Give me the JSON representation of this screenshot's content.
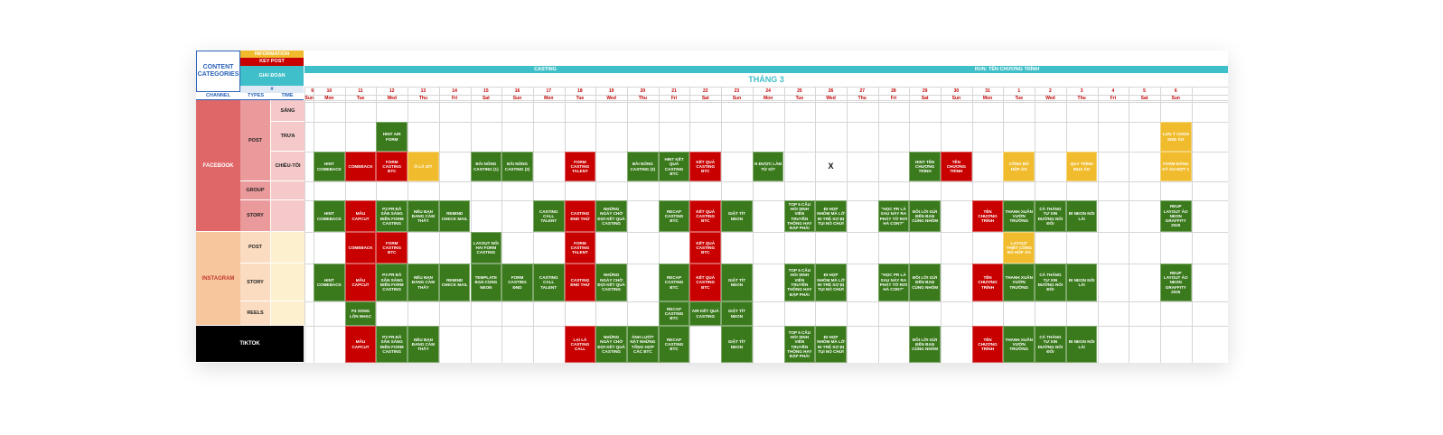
{
  "header": {
    "content_categories": "CONTENT CATEGORIES",
    "information": "INFORMATION",
    "key_post": "KEY POST",
    "giai_doan": "GIAI ĐOẠN",
    "hash": "#",
    "channel": "CHANNEL",
    "types": "TYPES",
    "time": "TIME",
    "phase_casting": "CASTING",
    "phase_run": "RUN: TÊN CHƯƠNG TRÌNH",
    "month": "THÁNG 3"
  },
  "colors": {
    "red": "#c80000",
    "green": "#3a7a1c",
    "yellow": "#f0bc2e",
    "teal": "#3fbfc9"
  },
  "days": [
    {
      "n": "9",
      "d": "Sun",
      "partial": true
    },
    {
      "n": "10",
      "d": "Mon"
    },
    {
      "n": "11",
      "d": "Tue"
    },
    {
      "n": "12",
      "d": "Wed"
    },
    {
      "n": "13",
      "d": "Thu"
    },
    {
      "n": "14",
      "d": "Fri"
    },
    {
      "n": "15",
      "d": "Sat"
    },
    {
      "n": "16",
      "d": "Sun"
    },
    {
      "n": "17",
      "d": "Mon"
    },
    {
      "n": "18",
      "d": "Tue"
    },
    {
      "n": "19",
      "d": "Wed"
    },
    {
      "n": "20",
      "d": "Thu"
    },
    {
      "n": "21",
      "d": "Fri"
    },
    {
      "n": "22",
      "d": "Sat"
    },
    {
      "n": "23",
      "d": "Sun"
    },
    {
      "n": "24",
      "d": "Mon"
    },
    {
      "n": "25",
      "d": "Tue"
    },
    {
      "n": "26",
      "d": "Wed"
    },
    {
      "n": "27",
      "d": "Thu"
    },
    {
      "n": "28",
      "d": "Fri"
    },
    {
      "n": "29",
      "d": "Sat"
    },
    {
      "n": "30",
      "d": "Sun"
    },
    {
      "n": "31",
      "d": "Mon"
    },
    {
      "n": "1",
      "d": "Tue"
    },
    {
      "n": "2",
      "d": "Wed"
    },
    {
      "n": "3",
      "d": "Thu"
    },
    {
      "n": "4",
      "d": "Fri"
    },
    {
      "n": "5",
      "d": "Sat"
    },
    {
      "n": "6",
      "d": "Sun"
    }
  ],
  "channels": [
    {
      "name": "FACEBOOK",
      "key": "fb"
    },
    {
      "name": "INSTAGRAM",
      "key": "ig"
    },
    {
      "name": "TIKTOK",
      "key": "tt"
    }
  ],
  "rows": [
    {
      "channel": "fb",
      "type": "POST",
      "time": "SÁNG"
    },
    {
      "channel": "fb",
      "type": "POST",
      "time": "TRƯA"
    },
    {
      "channel": "fb",
      "type": "POST",
      "time": "CHIỀU-TỐI"
    },
    {
      "channel": "fb",
      "type": "GROUP",
      "time": ""
    },
    {
      "channel": "fb",
      "type": "STORY",
      "time": ""
    },
    {
      "channel": "ig",
      "type": "POST",
      "time": ""
    },
    {
      "channel": "ig",
      "type": "STORY",
      "time": ""
    },
    {
      "channel": "ig",
      "type": "REELS",
      "time": ""
    },
    {
      "channel": "tt",
      "type": "",
      "time": ""
    }
  ],
  "cells": [
    {
      "r": 1,
      "c": 3,
      "t": "HINT AIR FORM",
      "k": "g"
    },
    {
      "r": 1,
      "c": 28,
      "t": "LƯU Ý CHỌN SIZE ÁO",
      "k": "y"
    },
    {
      "r": 2,
      "c": 1,
      "t": "HINT COMEBACK",
      "k": "g"
    },
    {
      "r": 2,
      "c": 2,
      "t": "COMEBACK",
      "k": "r"
    },
    {
      "r": 2,
      "c": 3,
      "t": "FORM CASTING BTC",
      "k": "r"
    },
    {
      "r": 2,
      "c": 4,
      "t": "Ô LÀ GÌ?",
      "k": "y"
    },
    {
      "r": 2,
      "c": 6,
      "t": "BÀI NÓNG CASTING (1)",
      "k": "g"
    },
    {
      "r": 2,
      "c": 7,
      "t": "BÀI NÓNG CASTING (2)",
      "k": "g"
    },
    {
      "r": 2,
      "c": 9,
      "t": "FORM CASTING TALENT",
      "k": "r"
    },
    {
      "r": 2,
      "c": 11,
      "t": "BÀI NÓNG CASTING (3)",
      "k": "g"
    },
    {
      "r": 2,
      "c": 12,
      "t": "HINT KẾT QUẢ CASTING BTC",
      "k": "g"
    },
    {
      "r": 2,
      "c": 13,
      "t": "KẾT QUẢ CASTING BTC",
      "k": "r"
    },
    {
      "r": 2,
      "c": 15,
      "t": "N ĐƯỢC LÀM TỪ GÌ?",
      "k": "g"
    },
    {
      "r": 2,
      "c": 17,
      "t": "X",
      "k": "x"
    },
    {
      "r": 2,
      "c": 20,
      "t": "HINT TÊN CHƯƠNG TRÌNH",
      "k": "g"
    },
    {
      "r": 2,
      "c": 21,
      "t": "TÊN CHƯƠNG TRÌNH",
      "k": "r"
    },
    {
      "r": 2,
      "c": 23,
      "t": "CÔNG BỐ HỘP ÁO",
      "k": "y"
    },
    {
      "r": 2,
      "c": 25,
      "t": "QUY TRÌNH MUA ÁO",
      "k": "y"
    },
    {
      "r": 2,
      "c": 28,
      "t": "FORM ĐĂNG KÝ ÁO ĐỢT 1",
      "k": "y"
    },
    {
      "r": 4,
      "c": 1,
      "t": "HINT COMEBACK",
      "k": "g"
    },
    {
      "r": 4,
      "c": 2,
      "t": "MẪU CAPCUT",
      "k": "r"
    },
    {
      "r": 4,
      "c": 3,
      "t": "P3 PR ĐÃ SẴN SÀNG ĐIỀN FORM CASTING",
      "k": "g"
    },
    {
      "r": 4,
      "c": 4,
      "t": "NẾU BẠN ĐANG CẢM THẤY",
      "k": "g"
    },
    {
      "r": 4,
      "c": 5,
      "t": "REMIND CHECK MAIL",
      "k": "g"
    },
    {
      "r": 4,
      "c": 8,
      "t": "CASTING CALL TALENT",
      "k": "g"
    },
    {
      "r": 4,
      "c": 9,
      "t": "CASTING ĐND THỬ",
      "k": "r"
    },
    {
      "r": 4,
      "c": 10,
      "t": "NHỮNG NGÀY CHỜ ĐỢI KẾT QUẢ CASTING",
      "k": "g"
    },
    {
      "r": 4,
      "c": 12,
      "t": "RECAP CASTING BTC",
      "k": "g"
    },
    {
      "r": 4,
      "c": 13,
      "t": "KẾT QUẢ CASTING BTC",
      "k": "r"
    },
    {
      "r": 4,
      "c": 14,
      "t": "GIẬT TÍT NEON",
      "k": "g"
    },
    {
      "r": 4,
      "c": 16,
      "t": "TOP 5 CÂU HỎI SINH VIÊN TRUYỀN THÔNG HAY ĐẶP PHẢI",
      "k": "g"
    },
    {
      "r": 4,
      "c": 17,
      "t": "ĐI HỌP NHÓM MÀ LỠ ĐI TRỄ SỢ BỊ TỤI NÓ CHỬI",
      "k": "g"
    },
    {
      "r": 4,
      "c": 19,
      "t": "\"HỌC PR LÀ SAU NÀY RA PHÁT TỜ RƠI HẢ CON?\"",
      "k": "g"
    },
    {
      "r": 4,
      "c": 20,
      "t": "ĐÔI LỜI GỬI ĐẾN BẠN CÙNG NHÓM",
      "k": "g"
    },
    {
      "r": 4,
      "c": 22,
      "t": "TÊN CHƯƠNG TRÌNH",
      "k": "r"
    },
    {
      "r": 4,
      "c": 23,
      "t": "THANH XUÂN VƯỜN TRƯỜNG",
      "k": "g"
    },
    {
      "r": 4,
      "c": 24,
      "t": "CÁ THÁNG TƯ XIN ĐƯỜNG NÓI ĐỐI",
      "k": "g"
    },
    {
      "r": 4,
      "c": 25,
      "t": "ĐI NEON NÓI LÁI",
      "k": "g"
    },
    {
      "r": 4,
      "c": 28,
      "t": "REUP LAYOUT ÁO NEON GRAFFITY 2025",
      "k": "g"
    },
    {
      "r": 5,
      "c": 2,
      "t": "COMEBACK",
      "k": "r"
    },
    {
      "r": 5,
      "c": 3,
      "t": "FORM CASTING BTC",
      "k": "r"
    },
    {
      "r": 5,
      "c": 6,
      "t": "LAYOUT NỐI HAI FORM CASTING",
      "k": "g"
    },
    {
      "r": 5,
      "c": 9,
      "t": "FORM CASTING TALENT",
      "k": "r"
    },
    {
      "r": 5,
      "c": 13,
      "t": "KẾT QUẢ CASTING BTC",
      "k": "r"
    },
    {
      "r": 5,
      "c": 23,
      "t": "LAYOUT THIẾT CÔNG BỐ HỘP ÁO",
      "k": "y"
    },
    {
      "r": 6,
      "c": 1,
      "t": "HINT COMEBACK",
      "k": "g"
    },
    {
      "r": 6,
      "c": 2,
      "t": "MẪU CAPCUT",
      "k": "r"
    },
    {
      "r": 6,
      "c": 3,
      "t": "P3 PR ĐÃ SẴN SÀNG ĐIỀN FORM CASTING",
      "k": "g"
    },
    {
      "r": 6,
      "c": 4,
      "t": "NẾU BẠN ĐANG CẢM THẤY",
      "k": "g"
    },
    {
      "r": 6,
      "c": 5,
      "t": "REMIND CHECK MAIL",
      "k": "g"
    },
    {
      "r": 6,
      "c": 6,
      "t": "TEMPLATE BẠN CÙNG NEON",
      "k": "g"
    },
    {
      "r": 6,
      "c": 7,
      "t": "FORM CASTING ĐND",
      "k": "g"
    },
    {
      "r": 6,
      "c": 8,
      "t": "CASTING CALL TALENT",
      "k": "g"
    },
    {
      "r": 6,
      "c": 9,
      "t": "CASTING ĐND THỬ",
      "k": "r"
    },
    {
      "r": 6,
      "c": 10,
      "t": "NHỮNG NGÀY CHỜ ĐỢI KẾT QUẢ CASTING",
      "k": "g"
    },
    {
      "r": 6,
      "c": 12,
      "t": "RECAP CASTING BTC",
      "k": "g"
    },
    {
      "r": 6,
      "c": 13,
      "t": "KẾT QUẢ CASTING BTC",
      "k": "r"
    },
    {
      "r": 6,
      "c": 14,
      "t": "GIẬT TÍT NEON",
      "k": "g"
    },
    {
      "r": 6,
      "c": 16,
      "t": "TOP 5 CÂU HỎI SINH VIÊN TRUYỀN THÔNG HAY ĐẶP PHẢI",
      "k": "g"
    },
    {
      "r": 6,
      "c": 17,
      "t": "ĐI HỌP NHÓM MÀ LỠ ĐI TRỄ SỢ BỊ TỤI NÓ CHỬI",
      "k": "g"
    },
    {
      "r": 6,
      "c": 19,
      "t": "\"HỌC PR LÀ SAU NÀY RA PHÁT TỜ RƠI HẢ CON?\"",
      "k": "g"
    },
    {
      "r": 6,
      "c": 20,
      "t": "ĐÔI LỜI GỬI ĐẾN BẠN CÙNG NHÓM",
      "k": "g"
    },
    {
      "r": 6,
      "c": 22,
      "t": "TÊN CHƯƠNG TRÌNH",
      "k": "r"
    },
    {
      "r": 6,
      "c": 23,
      "t": "THANH XUÂN VƯỜN TRƯỜNG",
      "k": "g"
    },
    {
      "r": 6,
      "c": 24,
      "t": "CÁ THÁNG TƯ XIN ĐƯỜNG NÓI ĐỐI",
      "k": "g"
    },
    {
      "r": 6,
      "c": 25,
      "t": "ĐI NEON NÓI LÁI",
      "k": "g"
    },
    {
      "r": 6,
      "c": 28,
      "t": "REUP LAYOUT ÁO NEON GRAFFITY 2025",
      "k": "g"
    },
    {
      "r": 7,
      "c": 2,
      "t": "P3 SONG LỒN NHẠC",
      "k": "g"
    },
    {
      "r": 7,
      "c": 12,
      "t": "RECAP CASTING BTC",
      "k": "g"
    },
    {
      "r": 7,
      "c": 13,
      "t": "AIR KẾT QUẢ CASTING",
      "k": "g"
    },
    {
      "r": 7,
      "c": 14,
      "t": "GIẬT TÍT NEON",
      "k": "g"
    },
    {
      "r": 8,
      "c": 2,
      "t": "MẪU CAPCUT",
      "k": "r"
    },
    {
      "r": 8,
      "c": 3,
      "t": "P3 PR ĐÃ SẴN SÀNG ĐIỀN FORM CASTING",
      "k": "g"
    },
    {
      "r": 8,
      "c": 4,
      "t": "NẾU BẠN ĐANG CẢM THẤY",
      "k": "g"
    },
    {
      "r": 8,
      "c": 9,
      "t": "LẠI LÀ CASTING CALL",
      "k": "r"
    },
    {
      "r": 8,
      "c": 10,
      "t": "NHỮNG NGÀY CHỜ ĐỢI KẾT QUẢ CASTING",
      "k": "g"
    },
    {
      "r": 8,
      "c": 11,
      "t": "ẢNH LƯỚT NẶT NHỮNG TỔNG HỢP CÁC BTC",
      "k": "g"
    },
    {
      "r": 8,
      "c": 12,
      "t": "RECAP CASTING BTC",
      "k": "g"
    },
    {
      "r": 8,
      "c": 14,
      "t": "GIẬT TÍT NEON",
      "k": "g"
    },
    {
      "r": 8,
      "c": 16,
      "t": "TOP 5 CÂU HỎI SINH VIÊN TRUYỀN THÔNG HAY ĐẶP PHẢI",
      "k": "g"
    },
    {
      "r": 8,
      "c": 17,
      "t": "ĐI HỌP NHÓM MÀ LỠ ĐI TRỄ SỢ BỊ TỤI NÓ CHỬI",
      "k": "g"
    },
    {
      "r": 8,
      "c": 20,
      "t": "ĐÔI LỜI GỬI ĐẾN BẠN CÙNG NHÓM",
      "k": "g"
    },
    {
      "r": 8,
      "c": 22,
      "t": "TÊN CHƯƠNG TRÌNH",
      "k": "r"
    },
    {
      "r": 8,
      "c": 23,
      "t": "THANH XUÂN VƯỜN TRƯỜNG",
      "k": "g"
    },
    {
      "r": 8,
      "c": 24,
      "t": "CÁ THÁNG TƯ XIN ĐƯỜNG NÓI ĐỐI",
      "k": "g"
    },
    {
      "r": 8,
      "c": 25,
      "t": "ĐI NEON NÓI LÁI",
      "k": "g"
    }
  ]
}
